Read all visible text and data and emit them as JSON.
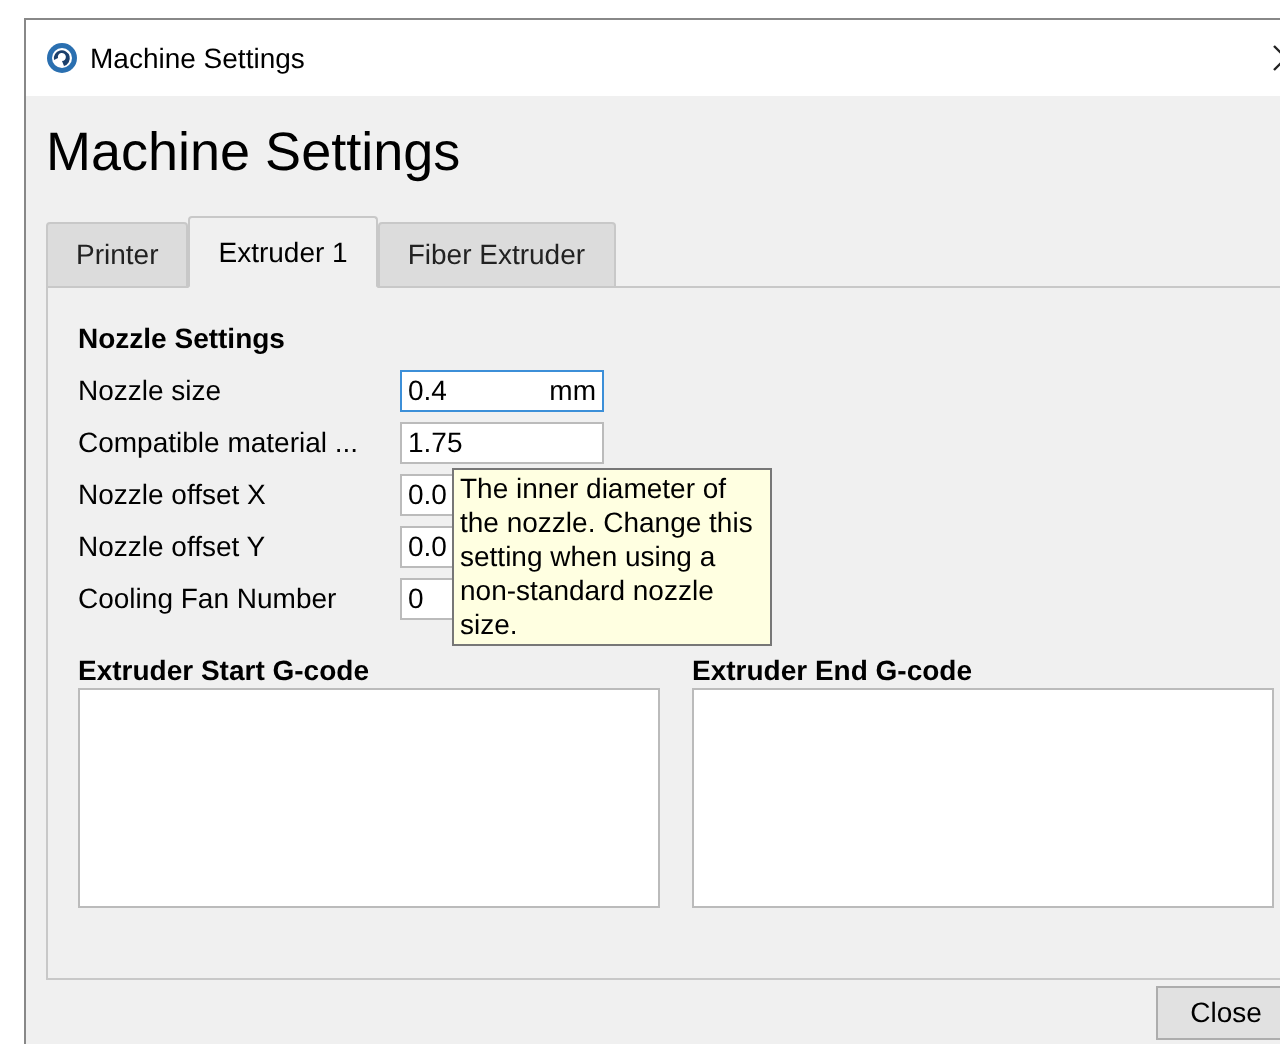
{
  "window": {
    "title": "Machine Settings"
  },
  "heading": "Machine Settings",
  "tabs": [
    {
      "label": "Printer",
      "selected": false
    },
    {
      "label": "Extruder 1",
      "selected": true
    },
    {
      "label": "Fiber Extruder",
      "selected": false
    }
  ],
  "section": "Nozzle Settings",
  "fields": [
    {
      "label": "Nozzle size",
      "value": "0.4",
      "unit": "mm",
      "focused": true
    },
    {
      "label": "Compatible material ...",
      "value": "1.75",
      "focused": false
    },
    {
      "label": "Nozzle offset X",
      "value": "0.0",
      "focused": false
    },
    {
      "label": "Nozzle offset Y",
      "value": "0.0",
      "focused": false
    },
    {
      "label": "Cooling Fan Number",
      "value": "0",
      "focused": false
    }
  ],
  "tooltip": "The inner diameter of the nozzle. Change this setting when using a non-standard nozzle size.",
  "gcode": [
    {
      "label": "Extruder Start G-code"
    },
    {
      "label": "Extruder End G-code"
    }
  ],
  "buttons": [
    "Close"
  ]
}
